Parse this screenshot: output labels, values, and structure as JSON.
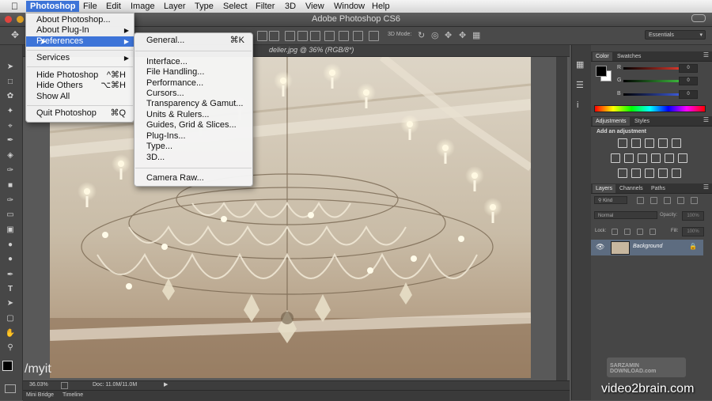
{
  "menubar": {
    "apple_icon": "apple-icon",
    "items": [
      "Photoshop",
      "File",
      "Edit",
      "Image",
      "Layer",
      "Type",
      "Select",
      "Filter",
      "3D",
      "View",
      "Window",
      "Help"
    ]
  },
  "window": {
    "title": "Adobe Photoshop CS6"
  },
  "options_bar": {
    "mode_label": "3D Mode:",
    "workspace": "Essentials"
  },
  "document": {
    "tab_label": "delier.jpg @ 36% (RGB/8*)",
    "zoom": "36.03%",
    "doc_size": "Doc: 11.0M/11.0M"
  },
  "bottom_tabs": [
    "Mini Bridge",
    "Timeline"
  ],
  "photoshop_menu": {
    "items": [
      {
        "label": "About Photoshop...",
        "shortcut": "",
        "submenu": false
      },
      {
        "label": "About Plug-In",
        "shortcut": "",
        "submenu": true
      },
      {
        "label": "Preferences",
        "shortcut": "",
        "submenu": true
      },
      {
        "label": "Services",
        "shortcut": "",
        "submenu": true
      },
      {
        "label": "Hide Photoshop",
        "shortcut": "^⌘H",
        "submenu": false
      },
      {
        "label": "Hide Others",
        "shortcut": "⌥⌘H",
        "submenu": false
      },
      {
        "label": "Show All",
        "shortcut": "",
        "submenu": false
      },
      {
        "label": "Quit Photoshop",
        "shortcut": "⌘Q",
        "submenu": false
      }
    ]
  },
  "preferences_menu": {
    "items": [
      {
        "label": "General...",
        "shortcut": "⌘K"
      },
      {
        "label": "Interface...",
        "shortcut": ""
      },
      {
        "label": "File Handling...",
        "shortcut": ""
      },
      {
        "label": "Performance...",
        "shortcut": ""
      },
      {
        "label": "Cursors...",
        "shortcut": ""
      },
      {
        "label": "Transparency & Gamut...",
        "shortcut": ""
      },
      {
        "label": "Units & Rulers...",
        "shortcut": ""
      },
      {
        "label": "Guides, Grid & Slices...",
        "shortcut": ""
      },
      {
        "label": "Plug-Ins...",
        "shortcut": ""
      },
      {
        "label": "Type...",
        "shortcut": ""
      },
      {
        "label": "3D...",
        "shortcut": ""
      },
      {
        "label": "Camera Raw...",
        "shortcut": ""
      }
    ]
  },
  "color_panel": {
    "tabs": [
      "Color",
      "Swatches"
    ],
    "channels": [
      {
        "name": "R",
        "value": "0",
        "color": "#e03a2e"
      },
      {
        "name": "G",
        "value": "0",
        "color": "#3fbf3f"
      },
      {
        "name": "B",
        "value": "0",
        "color": "#3f5ee0"
      }
    ]
  },
  "adjustments_panel": {
    "tabs": [
      "Adjustments",
      "Styles"
    ],
    "add_label": "Add an adjustment"
  },
  "layers_panel": {
    "tabs": [
      "Layers",
      "Channels",
      "Paths"
    ],
    "filter": "Kind",
    "blend_mode": "Normal",
    "opacity_label": "Opacity:",
    "opacity_value": "100%",
    "lock_label": "Lock:",
    "fill_label": "Fill:",
    "fill_value": "100%",
    "layer_name": "Background"
  },
  "overlay": {
    "left_text": "/myit",
    "watermark": "video2brain.com",
    "stamp": "SARZAMIN DOWNLOAD.com"
  },
  "colors": {
    "menu_highlight": "#3d74d8",
    "chrome": "#535353"
  }
}
